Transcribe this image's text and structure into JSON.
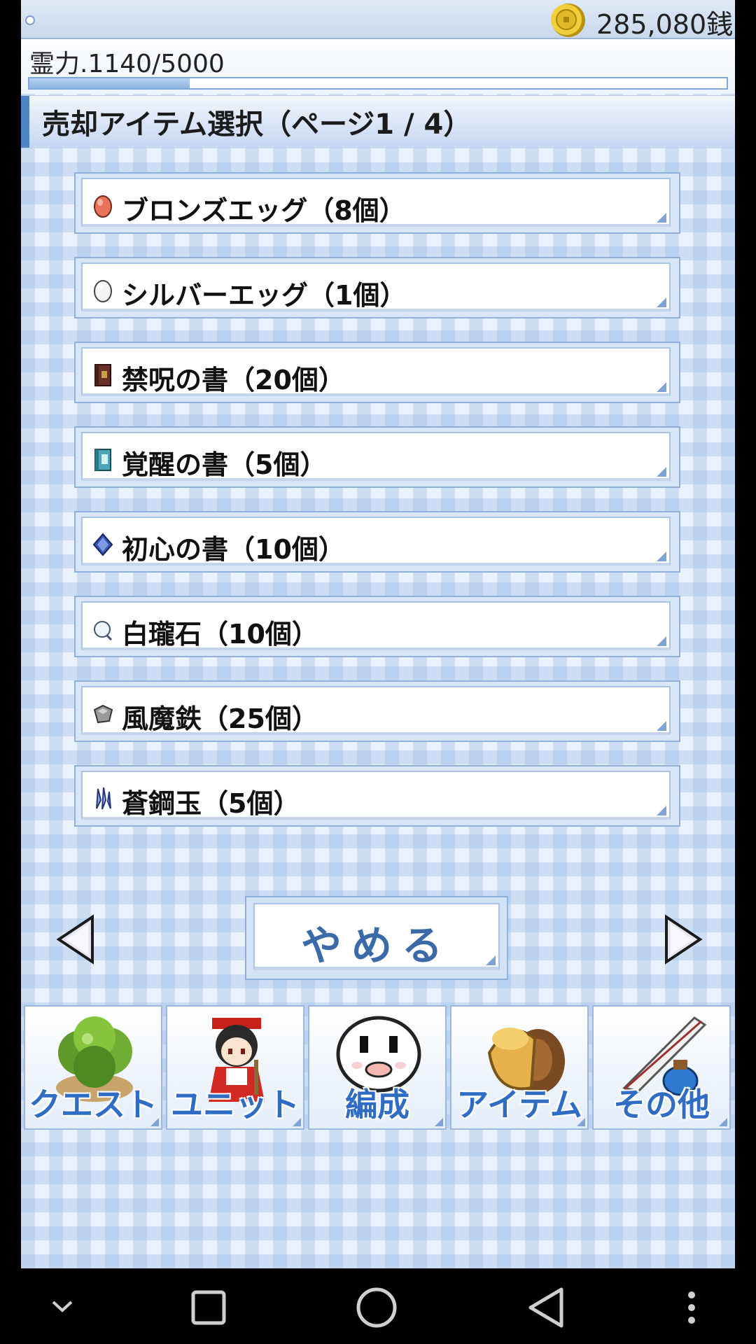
{
  "status": {
    "money": "285,080銭",
    "spirit_label": "霊力.1140/5000",
    "spirit_progress": 0.23
  },
  "header": {
    "title": "売却アイテム選択（ページ1 / 4）"
  },
  "items": [
    {
      "label": "ブロンズエッグ（8個）",
      "icon": "bronze-egg-icon"
    },
    {
      "label": "シルバーエッグ（1個）",
      "icon": "silver-egg-icon"
    },
    {
      "label": "禁呪の書（20個）",
      "icon": "forbidden-book-icon"
    },
    {
      "label": "覚醒の書（5個）",
      "icon": "awakening-book-icon"
    },
    {
      "label": "初心の書（10個）",
      "icon": "beginner-book-icon"
    },
    {
      "label": "白瓏石（10個）",
      "icon": "white-stone-icon"
    },
    {
      "label": "風魔鉄（25個）",
      "icon": "iron-ore-icon"
    },
    {
      "label": "蒼鋼玉（5個）",
      "icon": "blue-crystal-icon"
    }
  ],
  "pager": {
    "cancel_label": "やめる"
  },
  "menu": [
    {
      "label": "クエスト",
      "icon": "bush-icon"
    },
    {
      "label": "ユニット",
      "icon": "shrine-maiden-icon"
    },
    {
      "label": "編成",
      "icon": "white-spirit-icon"
    },
    {
      "label": "アイテム",
      "icon": "pouch-icon"
    },
    {
      "label": "その他",
      "icon": "quill-ink-icon"
    }
  ],
  "colors": {
    "accent": "#4c86c6",
    "menu_text": "#2f6cc4",
    "cancel_text": "#3a6aa8"
  }
}
